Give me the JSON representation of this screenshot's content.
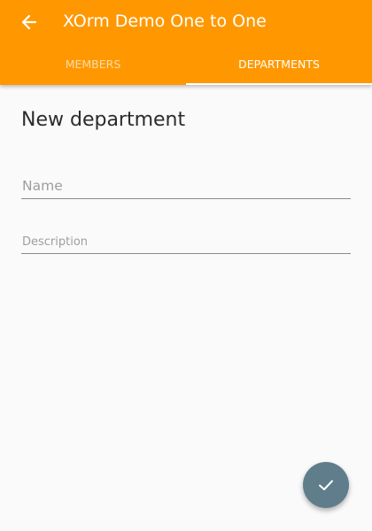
{
  "appbar": {
    "title": "XOrm Demo One to One",
    "back_icon": "arrow-back-icon",
    "color": "#ff9800"
  },
  "tabs": [
    {
      "label": "MEMBERS",
      "selected": false
    },
    {
      "label": "DEPARTMENTS",
      "selected": true
    }
  ],
  "form": {
    "title": "New department",
    "name_placeholder": "Name",
    "name_value": "",
    "description_placeholder": "Description",
    "description_value": ""
  },
  "fab": {
    "icon": "check-icon",
    "color": "#607d8b"
  }
}
